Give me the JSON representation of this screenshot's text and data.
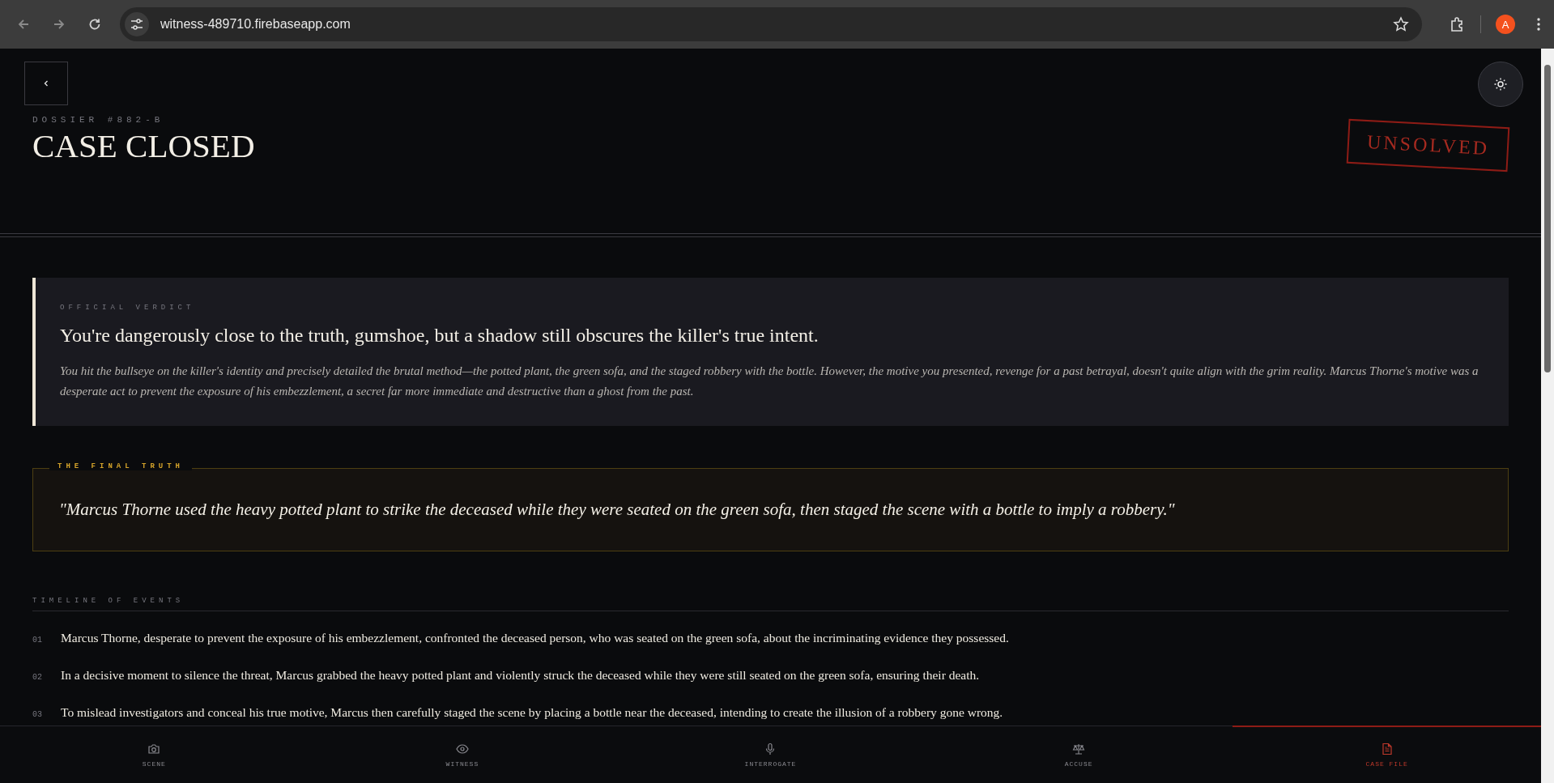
{
  "browser": {
    "url": "witness-489710.firebaseapp.com",
    "avatar": "A"
  },
  "header": {
    "eyebrow": "DOSSIER #882-B",
    "title": "CASE CLOSED",
    "stamp": "UNSOLVED"
  },
  "verdict": {
    "label": "OFFICIAL VERDICT",
    "headline": "You're dangerously close to the truth, gumshoe, but a shadow still obscures the killer's true intent.",
    "detail": "You hit the bullseye on the killer's identity and precisely detailed the brutal method—the potted plant, the green sofa, and the staged robbery with the bottle. However, the motive you presented, revenge for a past betrayal, doesn't quite align with the grim reality. Marcus Thorne's motive was a desperate act to prevent the exposure of his embezzlement, a secret far more immediate and destructive than a ghost from the past."
  },
  "final_truth": {
    "label": "THE FINAL TRUTH",
    "quote": "\"Marcus Thorne used the heavy potted plant to strike the deceased while they were seated on the green sofa, then staged the scene with a bottle to imply a robbery.\""
  },
  "timeline": {
    "label": "TIMELINE OF EVENTS",
    "events": [
      {
        "number": "01",
        "text": "Marcus Thorne, desperate to prevent the exposure of his embezzlement, confronted the deceased person, who was seated on the green sofa, about the incriminating evidence they possessed."
      },
      {
        "number": "02",
        "text": "In a decisive moment to silence the threat, Marcus grabbed the heavy potted plant and violently struck the deceased while they were still seated on the green sofa, ensuring their death."
      },
      {
        "number": "03",
        "text": "To mislead investigators and conceal his true motive, Marcus then carefully staged the scene by placing a bottle near the deceased, intending to create the illusion of a robbery gone wrong."
      }
    ]
  },
  "nav": [
    {
      "kind": "scene",
      "label": "SCENE",
      "selected": false
    },
    {
      "kind": "witness",
      "label": "WITNESS",
      "selected": false
    },
    {
      "kind": "interrogate",
      "label": "INTERROGATE",
      "selected": false
    },
    {
      "kind": "accuse",
      "label": "ACCUSE",
      "selected": false
    },
    {
      "kind": "casefile",
      "label": "CASE FILE",
      "selected": true
    }
  ]
}
